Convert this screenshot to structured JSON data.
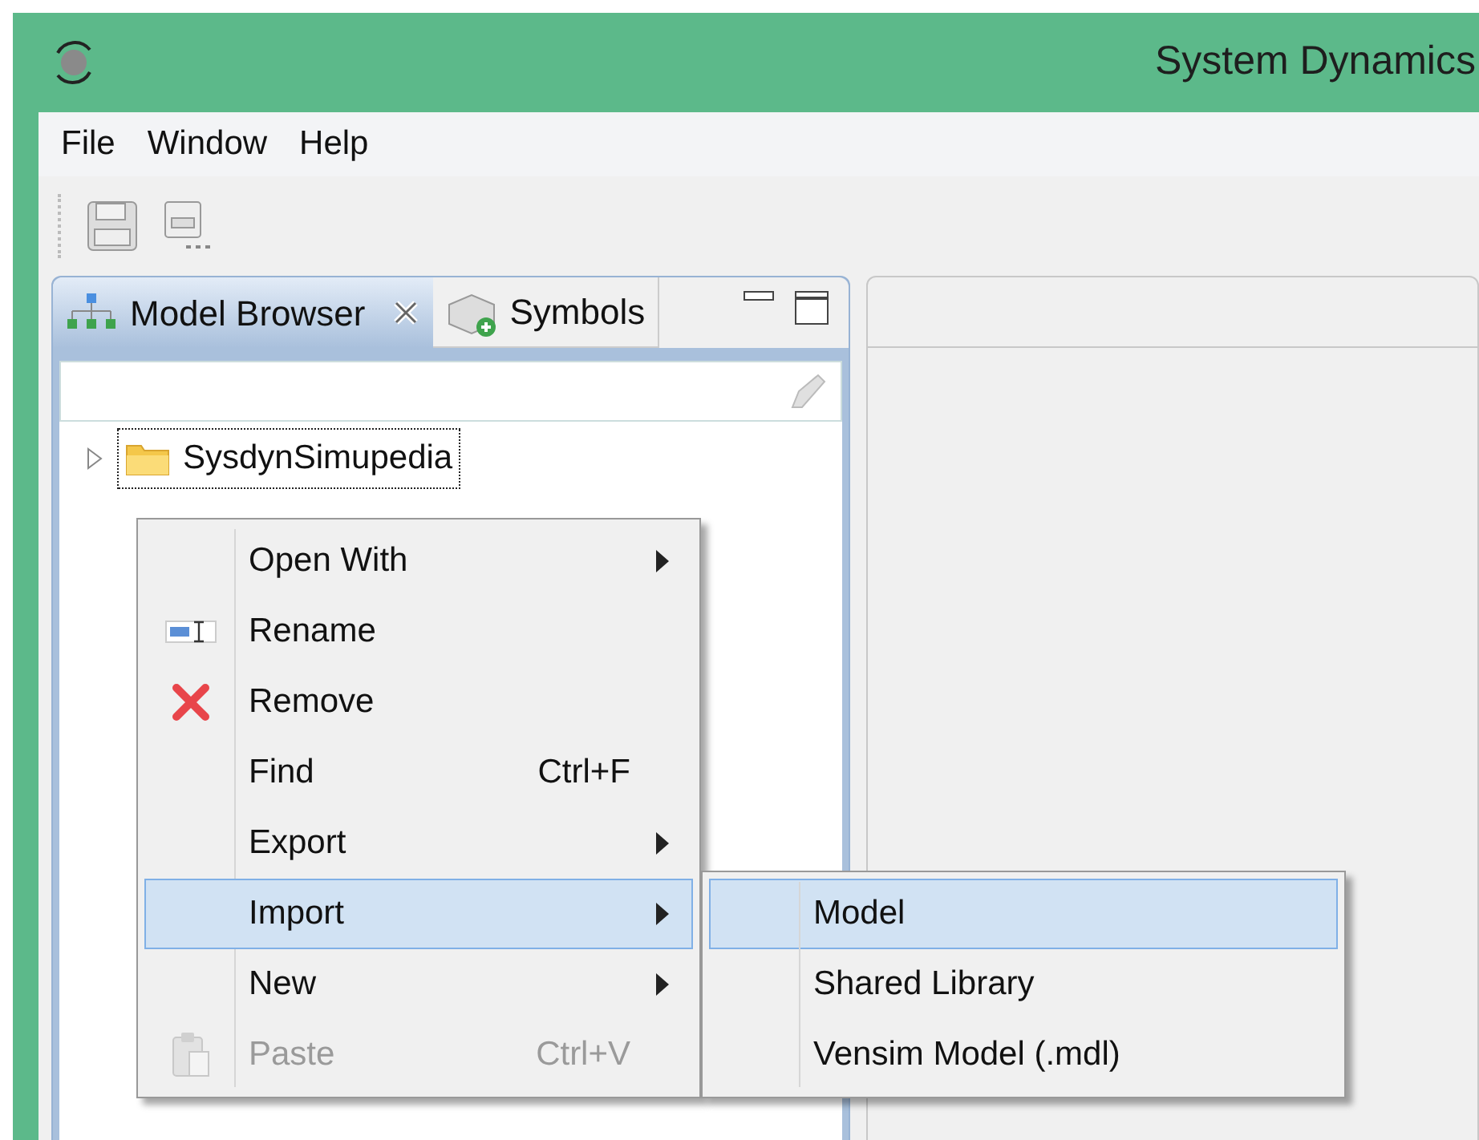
{
  "window": {
    "title": "System Dynamics"
  },
  "menu_bar": [
    "File",
    "Window",
    "Help"
  ],
  "panel": {
    "tabs": [
      {
        "label": "Model Browser",
        "selected": true,
        "closable": true
      },
      {
        "label": "Symbols",
        "selected": false,
        "closable": false
      }
    ]
  },
  "tree": [
    {
      "label": "SysdynSimupedia",
      "expanded": false,
      "focused": true
    }
  ],
  "context_menu": [
    {
      "label": "Open With",
      "kind": "plain",
      "submenu": true,
      "selected": false,
      "disabled": false
    },
    {
      "label": "Rename",
      "kind": "rename",
      "submenu": false,
      "selected": false,
      "disabled": false
    },
    {
      "label": "Remove",
      "kind": "remove",
      "submenu": false,
      "selected": false,
      "disabled": false
    },
    {
      "label": "Find",
      "kind": "plain",
      "shortcut": "Ctrl+F",
      "submenu": false,
      "selected": false,
      "disabled": false
    },
    {
      "label": "Export",
      "kind": "plain",
      "submenu": true,
      "selected": false,
      "disabled": false
    },
    {
      "label": "Import",
      "kind": "plain",
      "submenu": true,
      "selected": true,
      "disabled": false
    },
    {
      "label": "New",
      "kind": "plain",
      "submenu": true,
      "selected": false,
      "disabled": false
    },
    {
      "label": "Paste",
      "kind": "paste",
      "shortcut": "Ctrl+V",
      "submenu": false,
      "selected": false,
      "disabled": true
    }
  ],
  "submenu": [
    {
      "label": "Model",
      "selected": true
    },
    {
      "label": "Shared Library",
      "selected": false
    },
    {
      "label": "Vensim Model (.mdl)",
      "selected": false
    }
  ]
}
